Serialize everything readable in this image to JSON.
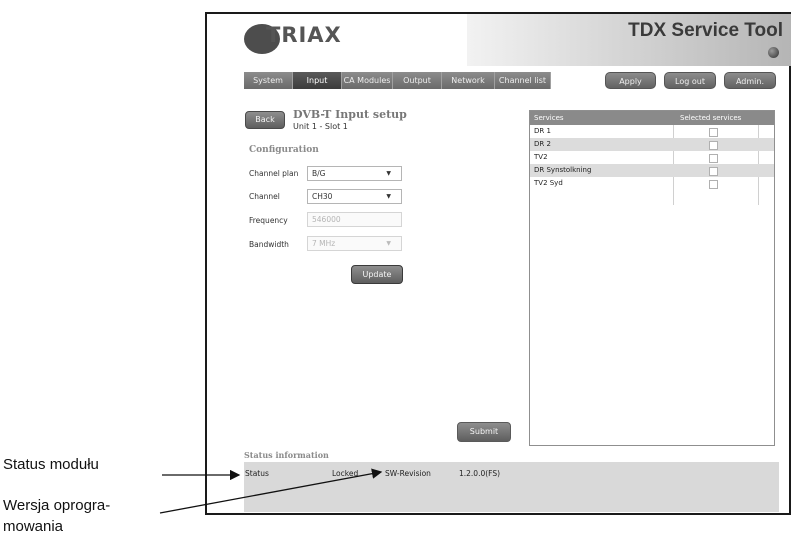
{
  "header": {
    "logo_text": "TRIAX",
    "app_title": "TDX Service Tool"
  },
  "nav": {
    "items": [
      {
        "label": "System"
      },
      {
        "label": "Input"
      },
      {
        "label": "CA Modules"
      },
      {
        "label": "Output"
      },
      {
        "label": "Network"
      },
      {
        "label": "Channel list"
      }
    ],
    "active": "Input",
    "apply_label": "Apply",
    "logout_label": "Log out",
    "admin_label": "Admin."
  },
  "page": {
    "back_label": "Back",
    "title": "DVB-T Input setup",
    "subtitle": "Unit 1 - Slot 1"
  },
  "config": {
    "heading": "Configuration",
    "channel_plan_label": "Channel plan",
    "channel_plan_value": "B/G",
    "channel_label": "Channel",
    "channel_value": "CH30",
    "frequency_label": "Frequency",
    "frequency_value": "546000",
    "bandwidth_label": "Bandwidth",
    "bandwidth_value": "7 MHz",
    "update_label": "Update"
  },
  "services": {
    "col_services": "Services",
    "col_selected": "Selected services",
    "rows": [
      {
        "name": "DR 1",
        "selected": false
      },
      {
        "name": "DR 2",
        "selected": false
      },
      {
        "name": "TV2",
        "selected": false
      },
      {
        "name": "DR Synstolkning",
        "selected": false
      },
      {
        "name": "TV2 Syd",
        "selected": false
      }
    ]
  },
  "submit_label": "Submit",
  "status": {
    "heading": "Status information",
    "status_label": "Status",
    "status_value": "Locked",
    "sw_label": "SW-Revision",
    "sw_value": "1.2.0.0(FS)"
  },
  "callouts": {
    "module_status": "Status modułu",
    "software_version_line1": "Wersja oprogra-",
    "software_version_line2": "mowania"
  },
  "colors": {
    "nav_bg": "#7a7a7a",
    "nav_active": "#444444",
    "table_header": "#8a8a8a",
    "status_bg": "#d9d9d9"
  }
}
